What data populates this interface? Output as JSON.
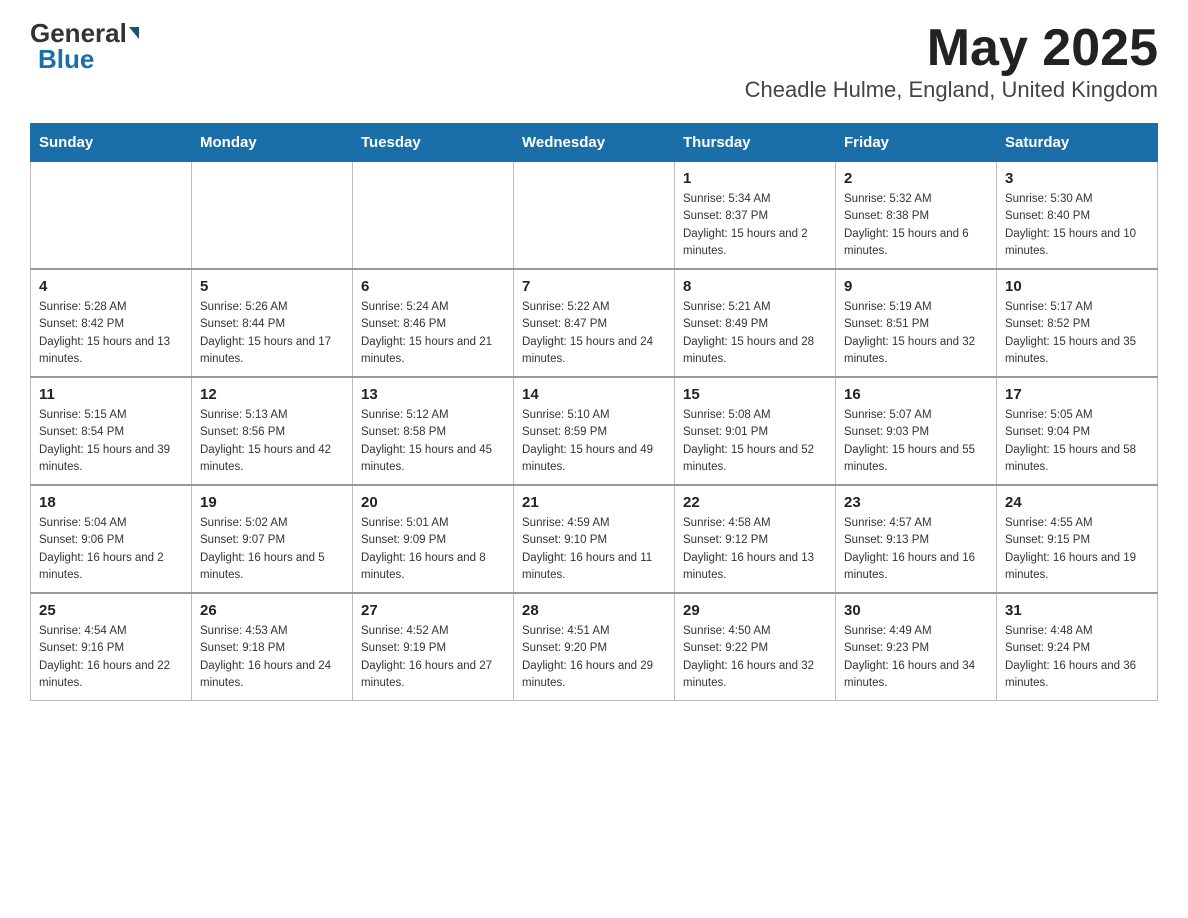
{
  "header": {
    "logo_general": "General",
    "logo_blue": "Blue",
    "title": "May 2025",
    "subtitle": "Cheadle Hulme, England, United Kingdom"
  },
  "days_of_week": [
    "Sunday",
    "Monday",
    "Tuesday",
    "Wednesday",
    "Thursday",
    "Friday",
    "Saturday"
  ],
  "weeks": [
    [
      {
        "day": "",
        "info": ""
      },
      {
        "day": "",
        "info": ""
      },
      {
        "day": "",
        "info": ""
      },
      {
        "day": "",
        "info": ""
      },
      {
        "day": "1",
        "info": "Sunrise: 5:34 AM\nSunset: 8:37 PM\nDaylight: 15 hours and 2 minutes."
      },
      {
        "day": "2",
        "info": "Sunrise: 5:32 AM\nSunset: 8:38 PM\nDaylight: 15 hours and 6 minutes."
      },
      {
        "day": "3",
        "info": "Sunrise: 5:30 AM\nSunset: 8:40 PM\nDaylight: 15 hours and 10 minutes."
      }
    ],
    [
      {
        "day": "4",
        "info": "Sunrise: 5:28 AM\nSunset: 8:42 PM\nDaylight: 15 hours and 13 minutes."
      },
      {
        "day": "5",
        "info": "Sunrise: 5:26 AM\nSunset: 8:44 PM\nDaylight: 15 hours and 17 minutes."
      },
      {
        "day": "6",
        "info": "Sunrise: 5:24 AM\nSunset: 8:46 PM\nDaylight: 15 hours and 21 minutes."
      },
      {
        "day": "7",
        "info": "Sunrise: 5:22 AM\nSunset: 8:47 PM\nDaylight: 15 hours and 24 minutes."
      },
      {
        "day": "8",
        "info": "Sunrise: 5:21 AM\nSunset: 8:49 PM\nDaylight: 15 hours and 28 minutes."
      },
      {
        "day": "9",
        "info": "Sunrise: 5:19 AM\nSunset: 8:51 PM\nDaylight: 15 hours and 32 minutes."
      },
      {
        "day": "10",
        "info": "Sunrise: 5:17 AM\nSunset: 8:52 PM\nDaylight: 15 hours and 35 minutes."
      }
    ],
    [
      {
        "day": "11",
        "info": "Sunrise: 5:15 AM\nSunset: 8:54 PM\nDaylight: 15 hours and 39 minutes."
      },
      {
        "day": "12",
        "info": "Sunrise: 5:13 AM\nSunset: 8:56 PM\nDaylight: 15 hours and 42 minutes."
      },
      {
        "day": "13",
        "info": "Sunrise: 5:12 AM\nSunset: 8:58 PM\nDaylight: 15 hours and 45 minutes."
      },
      {
        "day": "14",
        "info": "Sunrise: 5:10 AM\nSunset: 8:59 PM\nDaylight: 15 hours and 49 minutes."
      },
      {
        "day": "15",
        "info": "Sunrise: 5:08 AM\nSunset: 9:01 PM\nDaylight: 15 hours and 52 minutes."
      },
      {
        "day": "16",
        "info": "Sunrise: 5:07 AM\nSunset: 9:03 PM\nDaylight: 15 hours and 55 minutes."
      },
      {
        "day": "17",
        "info": "Sunrise: 5:05 AM\nSunset: 9:04 PM\nDaylight: 15 hours and 58 minutes."
      }
    ],
    [
      {
        "day": "18",
        "info": "Sunrise: 5:04 AM\nSunset: 9:06 PM\nDaylight: 16 hours and 2 minutes."
      },
      {
        "day": "19",
        "info": "Sunrise: 5:02 AM\nSunset: 9:07 PM\nDaylight: 16 hours and 5 minutes."
      },
      {
        "day": "20",
        "info": "Sunrise: 5:01 AM\nSunset: 9:09 PM\nDaylight: 16 hours and 8 minutes."
      },
      {
        "day": "21",
        "info": "Sunrise: 4:59 AM\nSunset: 9:10 PM\nDaylight: 16 hours and 11 minutes."
      },
      {
        "day": "22",
        "info": "Sunrise: 4:58 AM\nSunset: 9:12 PM\nDaylight: 16 hours and 13 minutes."
      },
      {
        "day": "23",
        "info": "Sunrise: 4:57 AM\nSunset: 9:13 PM\nDaylight: 16 hours and 16 minutes."
      },
      {
        "day": "24",
        "info": "Sunrise: 4:55 AM\nSunset: 9:15 PM\nDaylight: 16 hours and 19 minutes."
      }
    ],
    [
      {
        "day": "25",
        "info": "Sunrise: 4:54 AM\nSunset: 9:16 PM\nDaylight: 16 hours and 22 minutes."
      },
      {
        "day": "26",
        "info": "Sunrise: 4:53 AM\nSunset: 9:18 PM\nDaylight: 16 hours and 24 minutes."
      },
      {
        "day": "27",
        "info": "Sunrise: 4:52 AM\nSunset: 9:19 PM\nDaylight: 16 hours and 27 minutes."
      },
      {
        "day": "28",
        "info": "Sunrise: 4:51 AM\nSunset: 9:20 PM\nDaylight: 16 hours and 29 minutes."
      },
      {
        "day": "29",
        "info": "Sunrise: 4:50 AM\nSunset: 9:22 PM\nDaylight: 16 hours and 32 minutes."
      },
      {
        "day": "30",
        "info": "Sunrise: 4:49 AM\nSunset: 9:23 PM\nDaylight: 16 hours and 34 minutes."
      },
      {
        "day": "31",
        "info": "Sunrise: 4:48 AM\nSunset: 9:24 PM\nDaylight: 16 hours and 36 minutes."
      }
    ]
  ]
}
